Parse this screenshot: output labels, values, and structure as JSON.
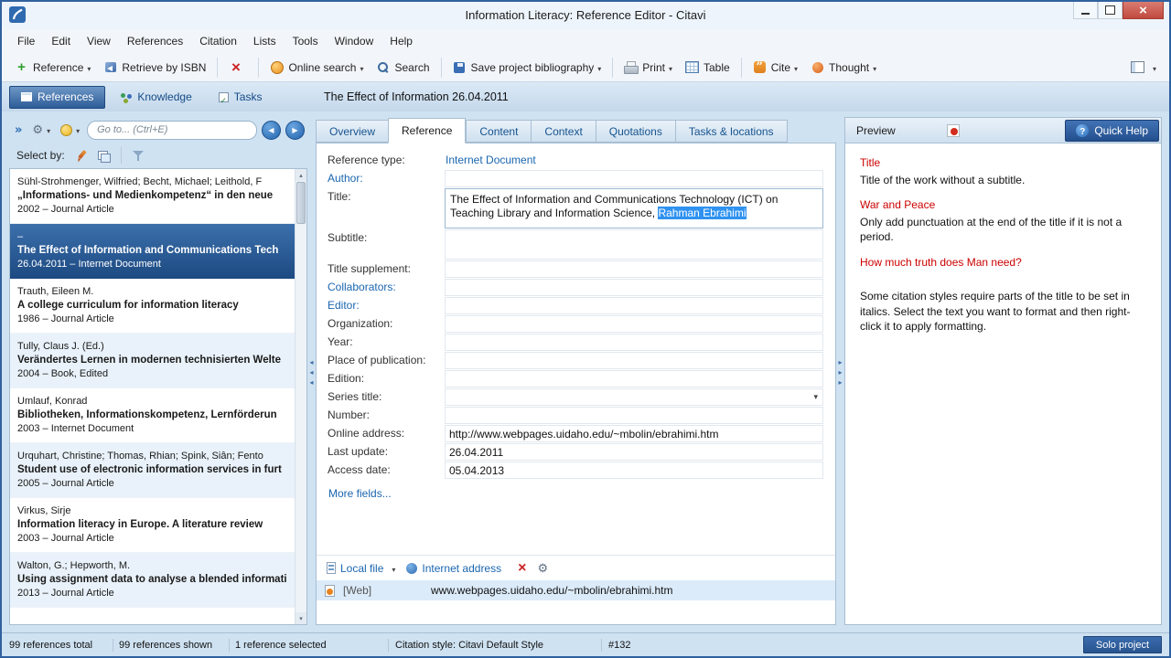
{
  "window": {
    "title": "Information Literacy: Reference Editor - Citavi"
  },
  "menubar": {
    "items": [
      "File",
      "Edit",
      "View",
      "References",
      "Citation",
      "Lists",
      "Tools",
      "Window",
      "Help"
    ]
  },
  "toolbar": {
    "buttons": [
      {
        "name": "new-reference",
        "label": "Reference",
        "icon": "plus",
        "dropdown": true
      },
      {
        "name": "retrieve-by-isbn",
        "label": "Retrieve by ISBN",
        "icon": "isbn"
      },
      {
        "sep": true
      },
      {
        "name": "delete-reference",
        "label": "",
        "icon": "delete"
      },
      {
        "sep": true
      },
      {
        "name": "online-search",
        "label": "Online search",
        "icon": "globe-search",
        "dropdown": true
      },
      {
        "name": "search",
        "label": "Search",
        "icon": "magnifier"
      },
      {
        "sep": true
      },
      {
        "name": "save-project-bibliography",
        "label": "Save project bibliography",
        "icon": "save",
        "dropdown": true
      },
      {
        "sep": true
      },
      {
        "name": "print",
        "label": "Print",
        "icon": "printer",
        "dropdown": true
      },
      {
        "name": "table",
        "label": "Table",
        "icon": "table"
      },
      {
        "sep": true
      },
      {
        "name": "cite",
        "label": "Cite",
        "icon": "cite",
        "dropdown": true
      },
      {
        "name": "thought",
        "label": "Thought",
        "icon": "thought",
        "dropdown": true
      }
    ]
  },
  "navbar": {
    "tabs": [
      {
        "label": "References",
        "icon": "references",
        "active": true
      },
      {
        "label": "Knowledge",
        "icon": "knowledge",
        "active": false
      },
      {
        "label": "Tasks",
        "icon": "tasks",
        "active": false
      }
    ],
    "document_title": "The Effect of Information 26.04.2011"
  },
  "sidebar": {
    "goto_placeholder": "Go to... (Ctrl+E)",
    "select_by_label": "Select by:",
    "references": [
      {
        "authors": "Sühl-Strohmenger, Wilfried; Becht, Michael; Leithold, F",
        "title": "„Informations- und Medienkompetenz“ in den neue",
        "meta": "2002 – Journal Article",
        "selected": false
      },
      {
        "authors": "–",
        "title": "The Effect of Information and Communications Tech",
        "meta": "26.04.2011 – Internet Document",
        "selected": true
      },
      {
        "authors": "Trauth, Eileen M.",
        "title": "A college curriculum for information literacy",
        "meta": "1986 – Journal Article",
        "selected": false
      },
      {
        "authors": "Tully, Claus J. (Ed.)",
        "title": "Verändertes Lernen in modernen technisierten Welte",
        "meta": "2004 – Book, Edited",
        "selected": false
      },
      {
        "authors": "Umlauf, Konrad",
        "title": "Bibliotheken, Informationskompetenz, Lernförderun",
        "meta": "2003 – Internet Document",
        "selected": false
      },
      {
        "authors": "Urquhart, Christine; Thomas, Rhian; Spink, Siân; Fento",
        "title": "Student use of electronic information services in furt",
        "meta": "2005 – Journal Article",
        "selected": false
      },
      {
        "authors": "Virkus, Sirje",
        "title": "Information literacy in Europe. A literature review",
        "meta": "2003 – Journal Article",
        "selected": false
      },
      {
        "authors": "Walton, G.; Hepworth, M.",
        "title": "Using assignment data to analyse a blended informati",
        "meta": "2013 – Journal Article",
        "selected": false
      }
    ]
  },
  "editor": {
    "tabs": [
      {
        "label": "Overview",
        "active": false
      },
      {
        "label": "Reference",
        "active": true
      },
      {
        "label": "Content",
        "active": false
      },
      {
        "label": "Context",
        "active": false
      },
      {
        "label": "Quotations",
        "active": false
      },
      {
        "label": "Tasks & locations",
        "active": false
      }
    ],
    "fields": [
      {
        "label": "Reference type:",
        "value": "Internet Document",
        "kind": "typelink"
      },
      {
        "label": "Author:",
        "value": "",
        "kind": "input",
        "link": true
      },
      {
        "label": "Title:",
        "kind": "title",
        "value_before": "The Effect of Information and Communications Technology (ICT) on Teaching Library and Information Science, ",
        "value_selected": "Rahman Ebrahimi"
      },
      {
        "label": "Subtitle:",
        "value": "",
        "kind": "input2"
      },
      {
        "label": "Title supplement:",
        "value": "",
        "kind": "input"
      },
      {
        "label": "Collaborators:",
        "value": "",
        "kind": "input",
        "link": true
      },
      {
        "label": "Editor:",
        "value": "",
        "kind": "input",
        "link": true
      },
      {
        "label": "Organization:",
        "value": "",
        "kind": "input"
      },
      {
        "label": "Year:",
        "value": "",
        "kind": "input"
      },
      {
        "label": "Place of publication:",
        "value": "",
        "kind": "input"
      },
      {
        "label": "Edition:",
        "value": "",
        "kind": "input"
      },
      {
        "label": "Series title:",
        "value": "",
        "kind": "select"
      },
      {
        "label": "Number:",
        "value": "",
        "kind": "input"
      },
      {
        "label": "Online address:",
        "value": "http://www.webpages.uidaho.edu/~mbolin/ebrahimi.htm",
        "kind": "input"
      },
      {
        "label": "Last update:",
        "value": "26.04.2011",
        "kind": "input"
      },
      {
        "label": "Access date:",
        "value": "05.04.2013",
        "kind": "input"
      }
    ],
    "more_fields_link": "More fields...",
    "attachments": {
      "local_file_label": "Local file",
      "internet_address_label": "Internet address",
      "item_tag": "[Web]",
      "item_url": "www.webpages.uidaho.edu/~mbolin/ebrahimi.htm"
    }
  },
  "preview": {
    "panel_label": "Preview",
    "quick_help_label": "Quick Help",
    "help": [
      {
        "style": "heading",
        "text": "Title"
      },
      {
        "style": "body",
        "text": "Title of the work without a subtitle."
      },
      {
        "style": "heading",
        "text": "War and Peace"
      },
      {
        "style": "body",
        "text": "Only add punctuation at the end of the title if it is not a period."
      },
      {
        "style": "heading",
        "text": "How much truth does Man need?"
      },
      {
        "style": "body",
        "gap": true,
        "text": "Some citation styles require parts of the title to be set in italics. Select the text you want to format and then right-click it to apply formatting."
      }
    ]
  },
  "statusbar": {
    "items": [
      "99 references total",
      "99 references shown",
      "1 reference selected",
      "Citation style: Citavi Default Style",
      "#132"
    ],
    "project_badge": "Solo project"
  },
  "colors": {
    "accent_blue": "#2d5c98",
    "selection_highlight": "#2f92f0",
    "help_heading_red": "#cc0000",
    "close_button_red": "#c04a3f",
    "selected_row_blue": "#1d4a82"
  }
}
